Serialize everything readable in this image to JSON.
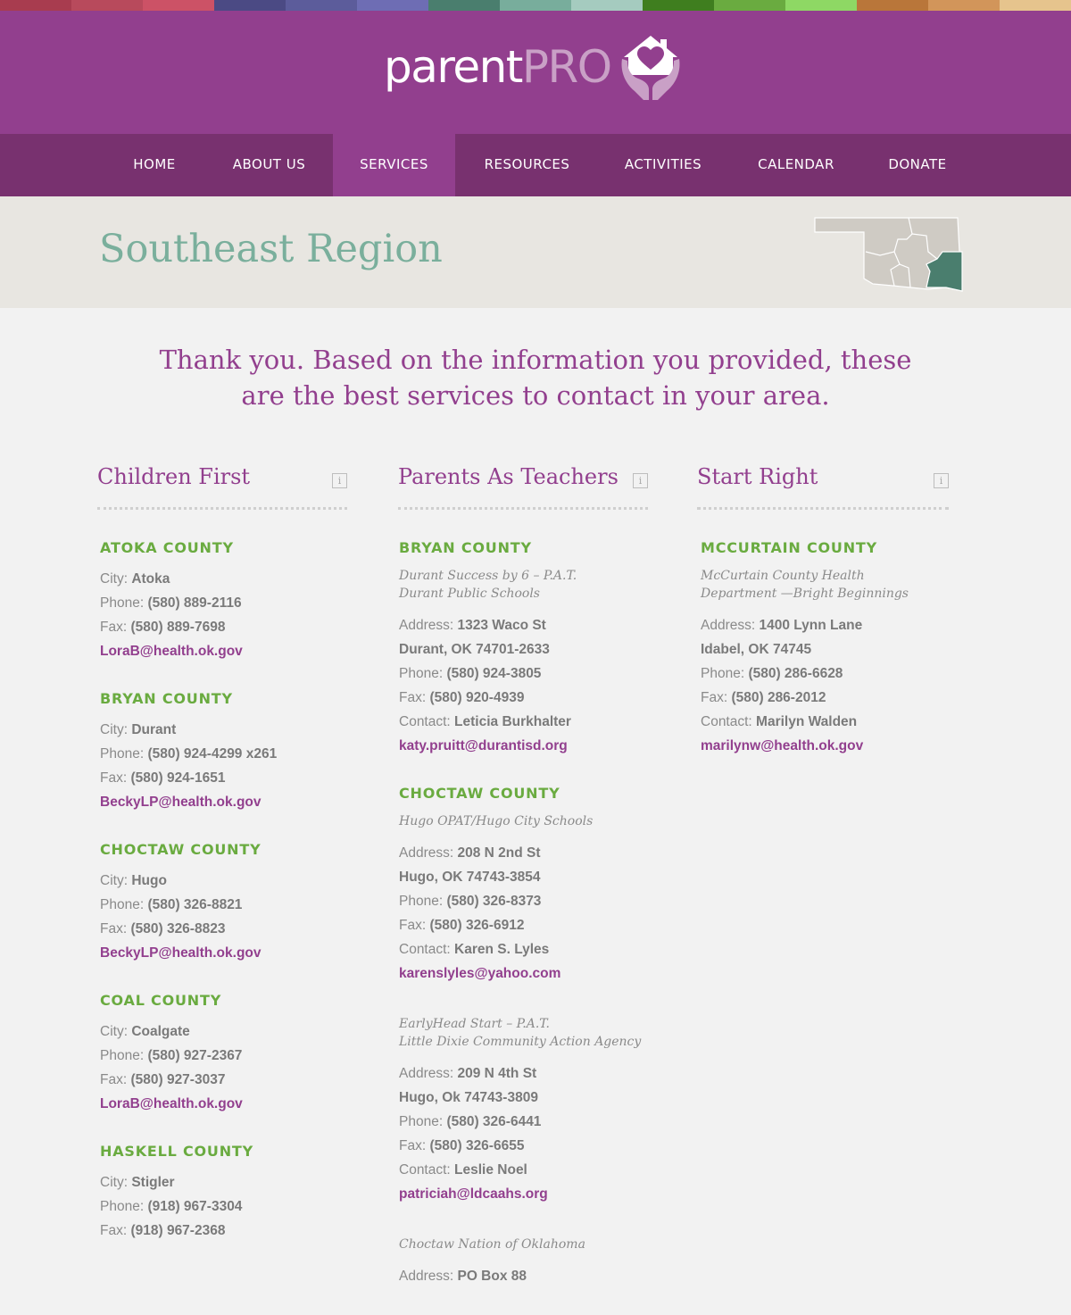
{
  "color_strip": [
    "#a83c4f",
    "#b84a5c",
    "#cc5266",
    "#4b4a84",
    "#5c5c9b",
    "#6e6db4",
    "#4a7e6e",
    "#78ad9c",
    "#a5cbbf",
    "#3f7e1f",
    "#6aab40",
    "#8ed864",
    "#b9763a",
    "#d2955a",
    "#e6c48d"
  ],
  "logo": {
    "word1": "parent",
    "word2": "PRO",
    "icon": "house-heart-hands-icon"
  },
  "nav": {
    "items": [
      {
        "label": "HOME"
      },
      {
        "label": "ABOUT US"
      },
      {
        "label": "SERVICES"
      },
      {
        "label": "RESOURCES"
      },
      {
        "label": "ACTIVITIES"
      },
      {
        "label": "CALENDAR"
      },
      {
        "label": "DONATE"
      }
    ],
    "active": "SERVICES"
  },
  "region": {
    "title": "Southeast Region",
    "map_icon": "oklahoma-region-map-icon"
  },
  "intro": {
    "line1": "Thank you. Based on the information you provided, these",
    "line2": "are the best services to contact in your area."
  },
  "labels": {
    "city": "City: ",
    "phone": "Phone: ",
    "fax": "Fax: ",
    "address": "Address: ",
    "contact": "Contact: ",
    "info": "i"
  },
  "columns": [
    {
      "title": "Children First",
      "counties": [
        {
          "name": "ATOKA COUNTY",
          "city": "Atoka",
          "phone": "(580) 889-2116",
          "fax": "(580) 889-7698",
          "email": "LoraB@health.ok.gov"
        },
        {
          "name": "BRYAN COUNTY",
          "city": "Durant",
          "phone": "(580) 924-4299 x261",
          "fax": "(580) 924-1651",
          "email": "BeckyLP@health.ok.gov"
        },
        {
          "name": "CHOCTAW COUNTY",
          "city": "Hugo",
          "phone": "(580) 326-8821",
          "fax": "(580) 326-8823",
          "email": "BeckyLP@health.ok.gov"
        },
        {
          "name": "COAL COUNTY",
          "city": "Coalgate",
          "phone": "(580) 927-2367",
          "fax": "(580) 927-3037",
          "email": "LoraB@health.ok.gov"
        },
        {
          "name": "HASKELL COUNTY",
          "city": "Stigler",
          "phone": "(918) 967-3304",
          "fax": "(918) 967-2368"
        }
      ]
    },
    {
      "title": "Parents As Teachers",
      "counties": [
        {
          "name": "BRYAN COUNTY",
          "agency_line1": "Durant Success by 6 – P.A.T.",
          "agency_line2": "Durant Public Schools",
          "address1": "1323 Waco St",
          "address2": "Durant, OK 74701-2633",
          "phone": "(580) 924-3805",
          "fax": "(580) 920-4939",
          "contact": "Leticia Burkhalter",
          "email": "katy.pruitt@durantisd.org"
        },
        {
          "name": "CHOCTAW COUNTY",
          "agency_line1": "Hugo OPAT/Hugo City Schools",
          "address1": "208 N 2nd St",
          "address2": "Hugo, OK 74743-3854",
          "phone": "(580) 326-8373",
          "fax": "(580) 326-6912",
          "contact": "Karen S. Lyles",
          "email": "karenslyles@yahoo.com",
          "agency2_line1": "EarlyHead Start – P.A.T.",
          "agency2_line2": "Little Dixie Community Action Agency",
          "agency2_address1": "209 N 4th St",
          "agency2_address2": "Hugo, Ok 74743-3809",
          "agency2_phone": "(580) 326-6441",
          "agency2_fax": "(580) 326-6655",
          "agency2_contact": "Leslie Noel",
          "agency2_email": "patriciah@ldcaahs.org",
          "agency3_line1": "Choctaw Nation of Oklahoma",
          "agency3_address1": "PO Box 88"
        }
      ]
    },
    {
      "title": "Start Right",
      "counties": [
        {
          "name": "MCCURTAIN COUNTY",
          "agency_line1": "McCurtain County Health",
          "agency_line2": "Department —Bright Beginnings",
          "address1": "1400 Lynn Lane",
          "address2": "Idabel, OK 74745",
          "phone": "(580) 286-6628",
          "fax": "(580) 286-2012",
          "contact": "Marilyn Walden",
          "email": "marilynw@health.ok.gov"
        }
      ]
    }
  ]
}
